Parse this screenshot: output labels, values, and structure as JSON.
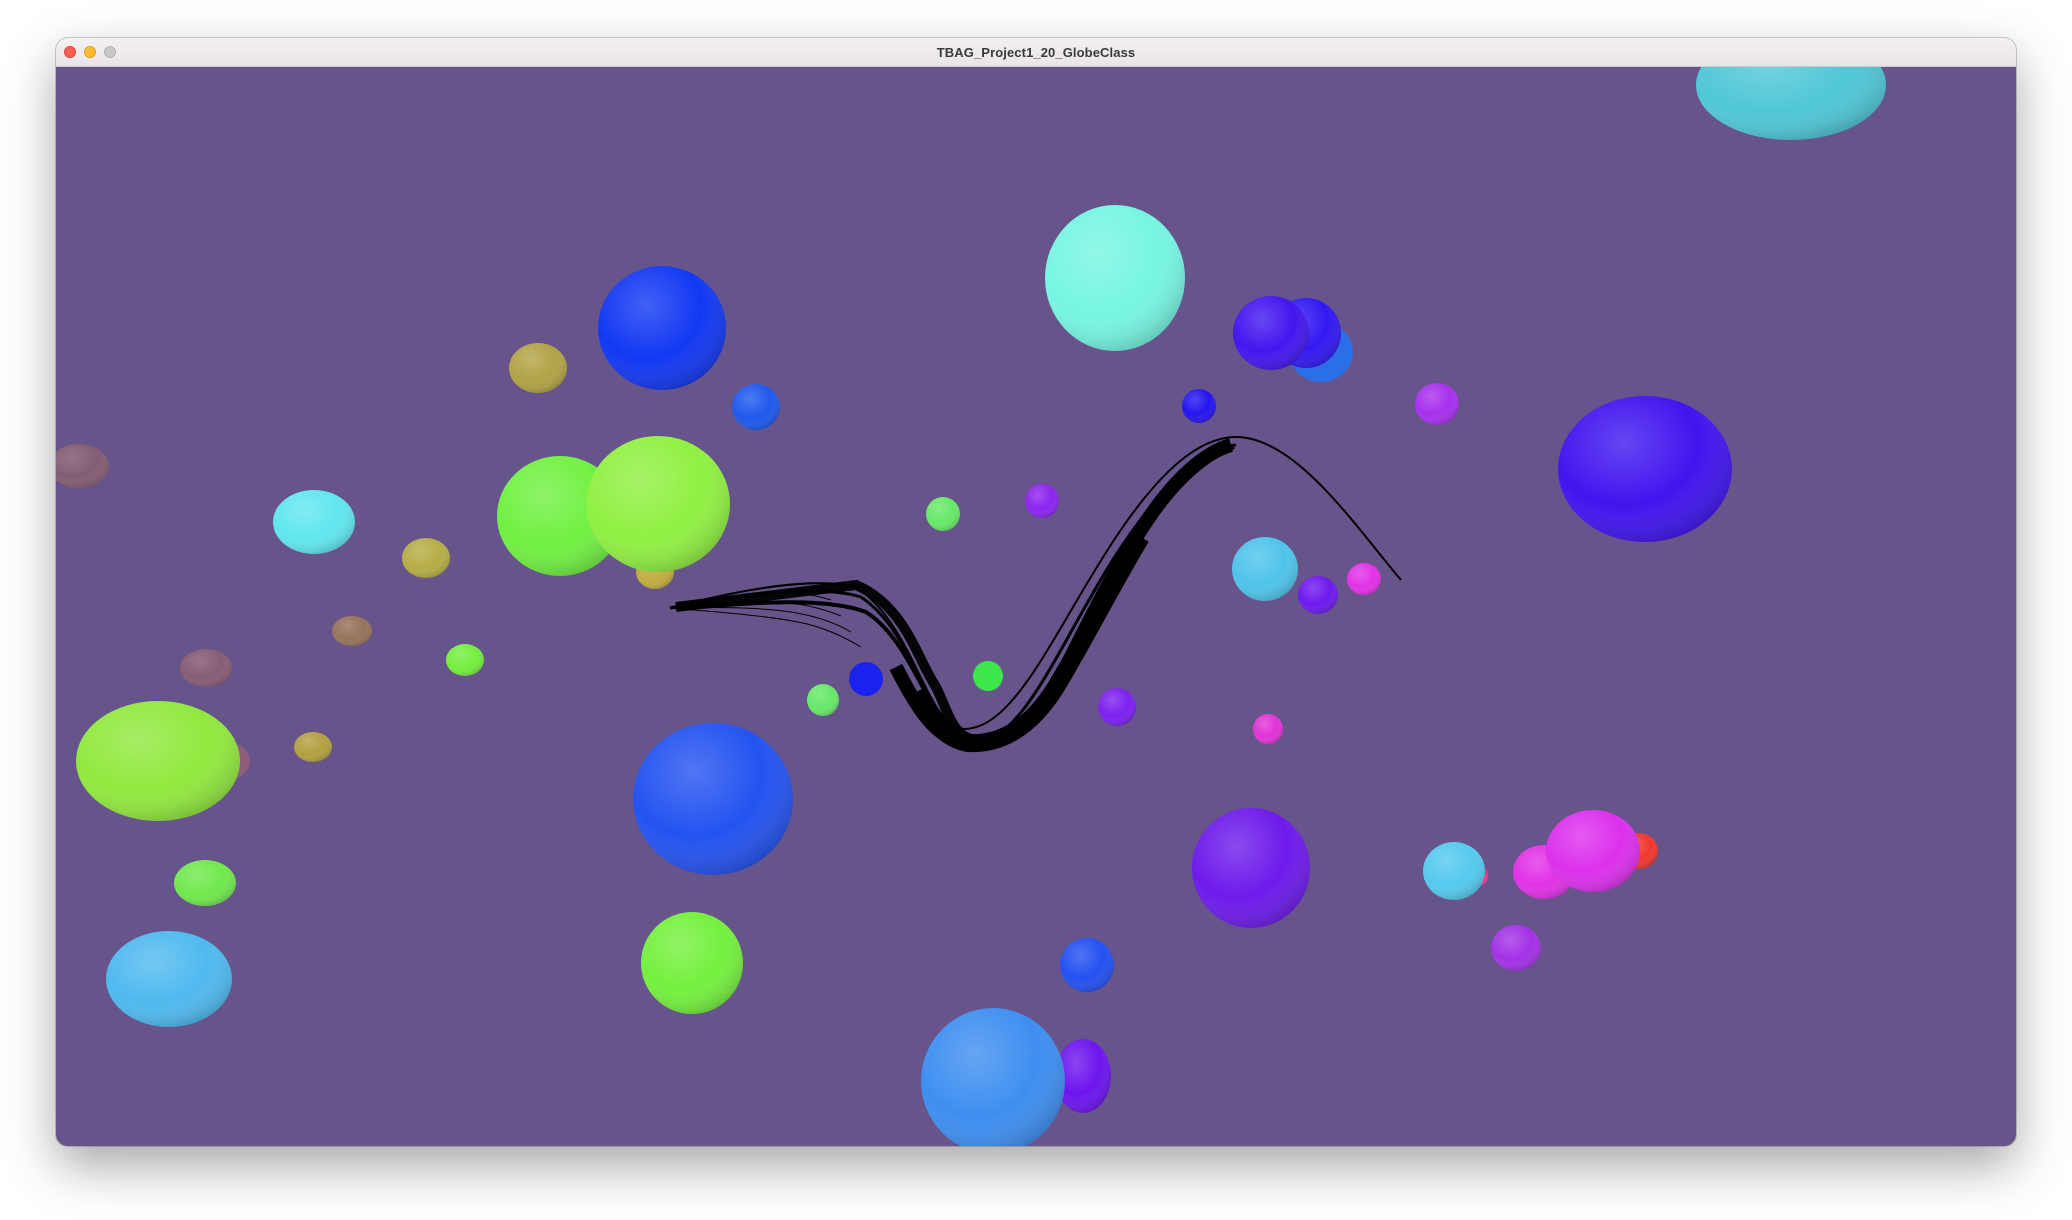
{
  "window": {
    "title": "TBAG_Project1_20_GlobeClass"
  },
  "scene": {
    "background_color": "#66548a",
    "object_count": 59,
    "ribbon_color": "#000000"
  }
}
